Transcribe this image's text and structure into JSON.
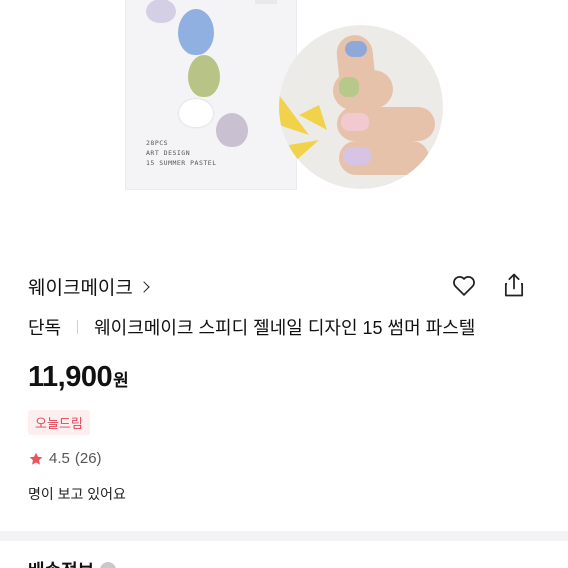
{
  "product_image": {
    "box_text_line1": "28PCS",
    "box_text_line2": "ART DESIGN",
    "box_text_line3": "15 SUMMER PASTEL"
  },
  "brand": {
    "name": "웨이크메이크"
  },
  "actions": {
    "like_icon": "heart-icon",
    "share_icon": "share-icon"
  },
  "product": {
    "tag": "단독",
    "title": "웨이크메이크 스피디 젤네일 디자인 15 썸머 파스텔",
    "price": "11,900",
    "price_unit": "원",
    "badge": "오늘드림",
    "rating": "4.5",
    "review_count": "(26)",
    "viewers_text": "명이 보고 있어요"
  },
  "shipping": {
    "section_title": "배송정보"
  },
  "colors": {
    "badge_text": "#e0475b",
    "badge_bg": "#fdeef0",
    "star": "#e9535f"
  }
}
